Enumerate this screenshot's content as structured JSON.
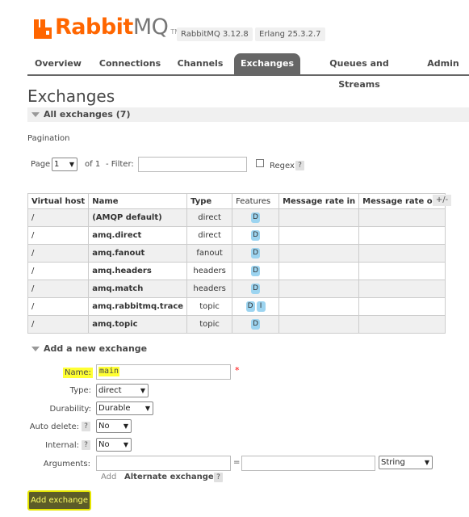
{
  "header": {
    "logo_rabbit": "Rabbit",
    "logo_mq": "MQ",
    "logo_tm": "TM",
    "version_badge": "RabbitMQ 3.12.8",
    "erlang_badge": "Erlang 25.3.2.7"
  },
  "nav": {
    "tabs": [
      {
        "label": "Overview"
      },
      {
        "label": "Connections"
      },
      {
        "label": "Channels"
      },
      {
        "label": "Exchanges"
      },
      {
        "label": "Queues and Streams"
      },
      {
        "label": "Admin"
      }
    ],
    "active": "Exchanges"
  },
  "page_title": "Exchanges",
  "all_exchanges_header": "All exchanges (7)",
  "pagination": {
    "label": "Pagination",
    "page_label": "Page",
    "page_value": "1",
    "of_label": "of 1",
    "filter_label": "- Filter:",
    "filter_value": "",
    "regex_label": "Regex",
    "help": "?"
  },
  "table": {
    "columns": [
      "Virtual host",
      "Name",
      "Type",
      "Features",
      "Message rate in",
      "Message rate out"
    ],
    "toggle": "+/-",
    "rows": [
      {
        "vhost": "/",
        "name": "(AMQP default)",
        "type": "direct",
        "features": [
          "D"
        ],
        "rate_in": "",
        "rate_out": ""
      },
      {
        "vhost": "/",
        "name": "amq.direct",
        "type": "direct",
        "features": [
          "D"
        ],
        "rate_in": "",
        "rate_out": ""
      },
      {
        "vhost": "/",
        "name": "amq.fanout",
        "type": "fanout",
        "features": [
          "D"
        ],
        "rate_in": "",
        "rate_out": ""
      },
      {
        "vhost": "/",
        "name": "amq.headers",
        "type": "headers",
        "features": [
          "D"
        ],
        "rate_in": "",
        "rate_out": ""
      },
      {
        "vhost": "/",
        "name": "amq.match",
        "type": "headers",
        "features": [
          "D"
        ],
        "rate_in": "",
        "rate_out": ""
      },
      {
        "vhost": "/",
        "name": "amq.rabbitmq.trace",
        "type": "topic",
        "features": [
          "D",
          "I"
        ],
        "rate_in": "",
        "rate_out": ""
      },
      {
        "vhost": "/",
        "name": "amq.topic",
        "type": "topic",
        "features": [
          "D"
        ],
        "rate_in": "",
        "rate_out": ""
      }
    ]
  },
  "add_exchange": {
    "header": "Add a new exchange",
    "name_label": "Name:",
    "name_value": "main",
    "required_mark": "*",
    "type_label": "Type:",
    "type_value": "direct",
    "durability_label": "Durability:",
    "durability_value": "Durable",
    "auto_delete_label": "Auto delete:",
    "auto_delete_value": "No",
    "internal_label": "Internal:",
    "internal_value": "No",
    "arguments_label": "Arguments:",
    "arg_key": "",
    "arg_eq": "=",
    "arg_value": "",
    "arg_type": "String",
    "add_link": "Add",
    "alternate_exchange": "Alternate exchange",
    "submit_label": "Add exchange"
  },
  "colors": {
    "brand_orange": "#ff6600",
    "nav_active": "#666666",
    "feature_badge": "#9cd4f0",
    "highlight_yellow": "#ffff33",
    "button_bg": "#5c5c28"
  }
}
